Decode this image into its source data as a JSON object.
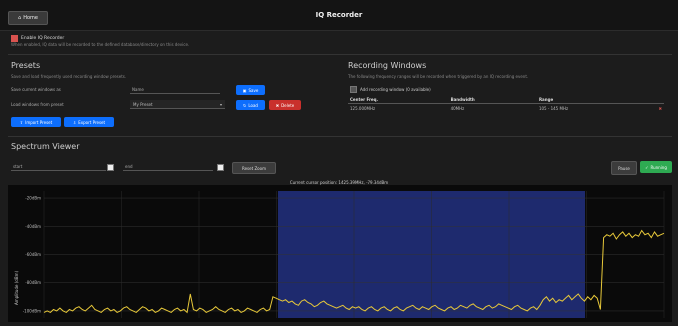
{
  "header": {
    "home_icon": "home-icon",
    "home_label": "Home",
    "title": "IQ Recorder"
  },
  "enable": {
    "label": "Enable IQ Recorder",
    "hint": "When enabled, IQ data will be recorded to the defined database/directory on this device."
  },
  "presets": {
    "title": "Presets",
    "hint": "Save and load frequently used recording window presets.",
    "save_label": "Save current windows as",
    "name_placeholder": "Name",
    "save_button": "Save",
    "load_label": "Load windows from preset",
    "load_select_value": "My Preset",
    "load_button": "Load",
    "delete_button": "Delete",
    "import_button": "Import Preset",
    "export_button": "Export Preset"
  },
  "recording_windows": {
    "title": "Recording Windows",
    "hint": "The following frequency ranges will be recorded when triggered by an IQ recording event.",
    "add_label": "Add recording window (0 available)",
    "columns": [
      "Center Freq.",
      "Bandwidth",
      "Range"
    ],
    "rows": [
      {
        "center": "125.000MHz",
        "bandwidth": "40MHz",
        "range": "105 - 145 MHz"
      }
    ]
  },
  "spectrum": {
    "title": "Spectrum Viewer",
    "start_value": "start",
    "end_value": "end",
    "reset_zoom": "Reset Zoom",
    "pause": "Pause",
    "running": "Running",
    "cursor_text": "Current cursor position: 1425.39MHz, -79.34dBm",
    "y_axis_label": "Amplitude (dBm)",
    "y_ticks": [
      "-20dBm",
      "-40dBm",
      "-60dBm",
      "-80dBm",
      "-100dBm"
    ],
    "accent": "#e8c93a",
    "selection_color": "#1e2a6e"
  },
  "chart_data": {
    "type": "line",
    "ylabel": "Amplitude (dBm)",
    "ylim": [
      -105,
      -15
    ],
    "y_ticks": [
      -20,
      -40,
      -60,
      -80,
      -100
    ],
    "grid": true,
    "series": [
      {
        "values": [
          -101,
          -100,
          -101,
          -99,
          -100,
          -98,
          -100,
          -101,
          -99,
          -100,
          -98,
          -97,
          -99,
          -100,
          -98,
          -96,
          -99,
          -100,
          -101,
          -99,
          -98,
          -100,
          -99,
          -101,
          -100,
          -98,
          -97,
          -99,
          -100,
          -101,
          -99,
          -97,
          -98,
          -100,
          -99,
          -101,
          -100,
          -98,
          -99,
          -100,
          -101,
          -99,
          -98,
          -100,
          -99,
          -101,
          -88,
          -99,
          -100,
          -98,
          -99,
          -101,
          -100,
          -99,
          -97,
          -99,
          -100,
          -101,
          -99,
          -98,
          -100,
          -99,
          -101,
          -100,
          -98,
          -99,
          -100,
          -101,
          -99,
          -98,
          -100,
          -99,
          -90,
          -91,
          -92,
          -93,
          -92,
          -94,
          -93,
          -95,
          -96,
          -93,
          -92,
          -94,
          -95,
          -97,
          -96,
          -94,
          -93,
          -95,
          -96,
          -97,
          -98,
          -97,
          -96,
          -98,
          -99,
          -97,
          -98,
          -97,
          -99,
          -100,
          -98,
          -97,
          -99,
          -100,
          -98,
          -97,
          -99,
          -100,
          -98,
          -97,
          -99,
          -100,
          -98,
          -97,
          -96,
          -98,
          -99,
          -97,
          -98,
          -99,
          -97,
          -96,
          -98,
          -99,
          -100,
          -98,
          -97,
          -99,
          -98,
          -96,
          -97,
          -98,
          -96,
          -95,
          -97,
          -98,
          -99,
          -97,
          -96,
          -98,
          -97,
          -95,
          -96,
          -97,
          -98,
          -99,
          -97,
          -96,
          -98,
          -99,
          -100,
          -98,
          -97,
          -99,
          -96,
          -92,
          -90,
          -93,
          -91,
          -94,
          -92,
          -93,
          -91,
          -89,
          -92,
          -90,
          -88,
          -91,
          -93,
          -90,
          -92,
          -89,
          -91,
          -99,
          -48,
          -46,
          -47,
          -45,
          -49,
          -46,
          -44,
          -47,
          -45,
          -48,
          -46,
          -47,
          -43,
          -46,
          -45,
          -48,
          -44,
          -47,
          -46,
          -45
        ]
      }
    ]
  }
}
